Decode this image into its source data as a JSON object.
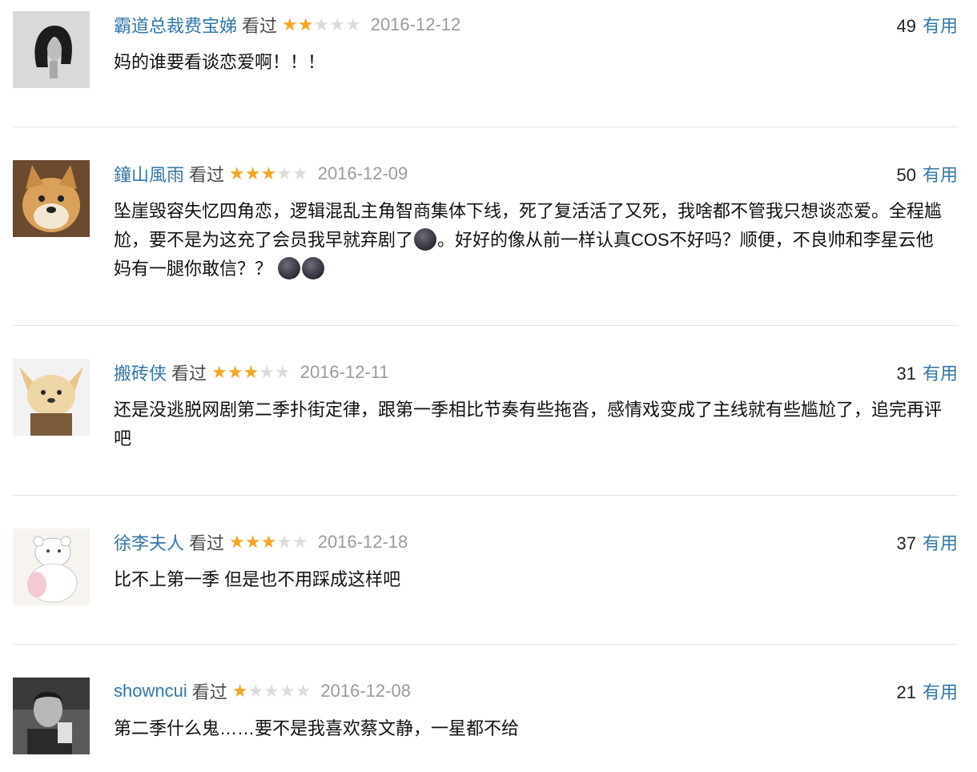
{
  "status_label": "看过",
  "useful_label": "有用",
  "colors": {
    "link": "#3377aa",
    "star_on": "#f5a623",
    "star_off": "#dcdcdc",
    "date": "#9b9b9b"
  },
  "comments": [
    {
      "user": "霸道总裁费宝娣",
      "rating": 2,
      "rating_max": 5,
      "date": "2016-12-12",
      "votes": "49",
      "text": "妈的谁要看谈恋爱啊！！！",
      "avatar_icon": "bob-haircut-portrait-avatar"
    },
    {
      "user": "鐘山風雨",
      "rating": 3,
      "rating_max": 5,
      "date": "2016-12-09",
      "votes": "50",
      "text_parts": [
        "坠崖毁容失忆四角恋，逻辑混乱主角智商集体下线，死了复活活了又死，我啥都不管我只想谈恋爱。全程尴尬，要不是为这充了会员我早就弃剧了",
        "。好好的像从前一样认真COS不好吗？顺便，不良帅和李星云他妈有一腿你敢信？？"
      ],
      "avatar_icon": "shiba-dog-avatar",
      "emoji_icon": "new-moon-face-emoji"
    },
    {
      "user": "搬砖侠",
      "rating": 3,
      "rating_max": 5,
      "date": "2016-12-11",
      "votes": "31",
      "text": "还是没逃脱网剧第二季扑街定律，跟第一季相比节奏有些拖沓，感情戏变成了主线就有些尴尬了，追完再评吧",
      "avatar_icon": "cartoon-dog-costume-avatar"
    },
    {
      "user": "徐李夫人",
      "rating": 3,
      "rating_max": 5,
      "date": "2016-12-18",
      "votes": "37",
      "text": "比不上第一季 但是也不用踩成这样吧",
      "avatar_icon": "bear-sketch-avatar"
    },
    {
      "user": "showncui",
      "rating": 1,
      "rating_max": 5,
      "date": "2016-12-08",
      "votes": "21",
      "text": "第二季什么鬼……要不是我喜欢蔡文静，一星都不给",
      "avatar_icon": "bw-photo-person-avatar"
    }
  ]
}
